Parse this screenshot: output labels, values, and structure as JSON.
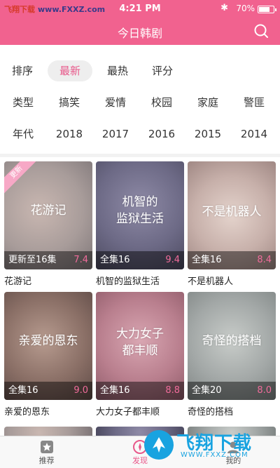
{
  "statusbar": {
    "carrier": "飞翔下载",
    "site": "www.FXXZ.com",
    "time": "4:21 PM",
    "battery": "70%",
    "battery_level": 0.7
  },
  "navbar": {
    "title": "今日韩剧"
  },
  "filters": {
    "sort": {
      "label": "排序",
      "options": [
        "最新",
        "最热",
        "评分"
      ],
      "selected": "最新"
    },
    "genre": {
      "label": "类型",
      "options": [
        "搞笑",
        "爱情",
        "校园",
        "家庭",
        "警匪"
      ]
    },
    "year": {
      "label": "年代",
      "options": [
        "2018",
        "2017",
        "2016",
        "2015",
        "2014"
      ]
    }
  },
  "dramas": [
    {
      "poster_title": "花游记",
      "status": "更新至16集",
      "score": "7.4",
      "name": "花游记",
      "ribbon": "更新"
    },
    {
      "poster_title": "机智的\n监狱生活",
      "status": "全集16",
      "score": "9.4",
      "name": "机智的监狱生活"
    },
    {
      "poster_title": "不是机器人",
      "status": "全集16",
      "score": "8.4",
      "name": "不是机器人"
    },
    {
      "poster_title": "亲爱的恩东",
      "status": "全集16",
      "score": "9.0",
      "name": "亲爱的恩东"
    },
    {
      "poster_title": "大力女子\n都丰顺",
      "status": "全集16",
      "score": "8.8",
      "name": "大力女子都丰顺"
    },
    {
      "poster_title": "奇怪的搭档",
      "status": "全集20",
      "score": "8.0",
      "name": "奇怪的搭档"
    }
  ],
  "tabs": [
    {
      "label": "推荐"
    },
    {
      "label": "发现"
    },
    {
      "label": "我的"
    }
  ],
  "active_tab": "发现",
  "watermark": {
    "text": "飞翔下载",
    "site": "WWW.FXXZ.COM"
  },
  "colors": {
    "accent": "#f1628f",
    "score": "#f06c9b",
    "watermark": "#19a3e0"
  }
}
